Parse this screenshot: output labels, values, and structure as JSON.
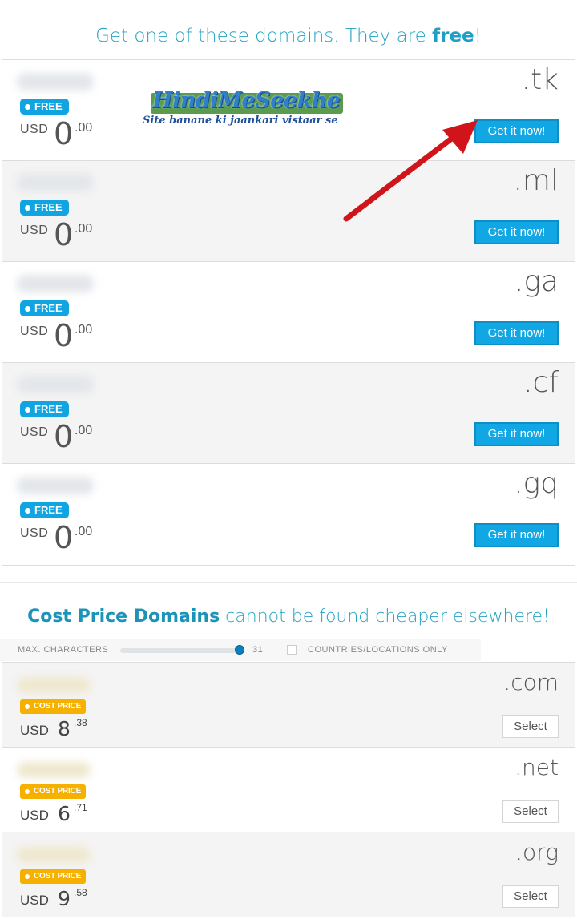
{
  "free_section": {
    "title_prefix": "Get one of these domains. They are ",
    "title_bold": "free",
    "title_suffix": "!",
    "badge_label": "FREE",
    "button_label": "Get it now!",
    "domains": [
      {
        "tld": ".tk",
        "currency": "USD",
        "price_int": "0",
        "price_dec": ".00"
      },
      {
        "tld": ".ml",
        "currency": "USD",
        "price_int": "0",
        "price_dec": ".00"
      },
      {
        "tld": ".ga",
        "currency": "USD",
        "price_int": "0",
        "price_dec": ".00"
      },
      {
        "tld": ".cf",
        "currency": "USD",
        "price_int": "0",
        "price_dec": ".00"
      },
      {
        "tld": ".gq",
        "currency": "USD",
        "price_int": "0",
        "price_dec": ".00"
      }
    ]
  },
  "watermark": {
    "title": "HindiMeSeekhe",
    "subtitle": "Site banane ki jaankari vistaar se"
  },
  "cost_section": {
    "title_bold": "Cost Price Domains",
    "title_rest": " cannot be found cheaper elsewhere!",
    "filter": {
      "max_chars_label": "MAX. CHARACTERS",
      "max_chars_value": "31",
      "countries_label": "COUNTRIES/LOCATIONS ONLY"
    },
    "badge_label": "COST PRICE",
    "button_label": "Select",
    "domains": [
      {
        "tld": ".com",
        "currency": "USD",
        "price_int": "8",
        "price_dec": ".38"
      },
      {
        "tld": ".net",
        "currency": "USD",
        "price_int": "6",
        "price_dec": ".71"
      },
      {
        "tld": ".org",
        "currency": "USD",
        "price_int": "9",
        "price_dec": ".58"
      }
    ]
  },
  "colors": {
    "accent_blue": "#11a7e4",
    "cost_yellow": "#f6b100",
    "arrow_red": "#d0141a"
  }
}
